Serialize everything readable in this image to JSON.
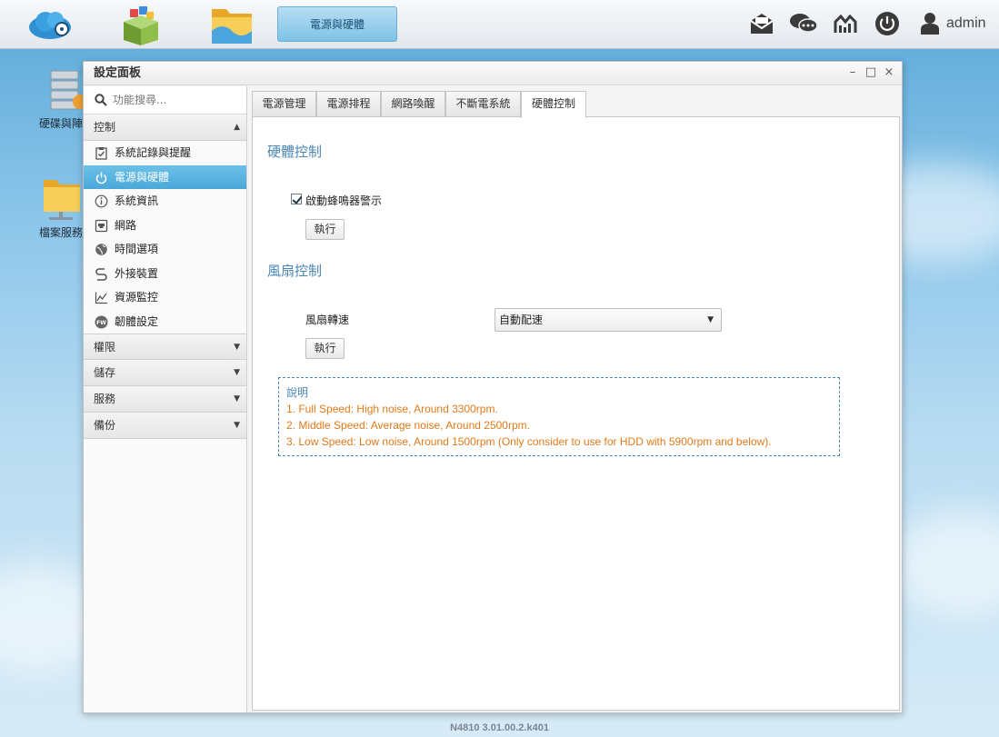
{
  "taskbar": {
    "active_task_label": "電源與硬體",
    "user_label": "admin",
    "icons": [
      "cloud-app-icon",
      "app-center-icon",
      "file-manager-icon",
      "mail-icon",
      "chat-icon",
      "tools-icon",
      "power-icon",
      "user-icon"
    ]
  },
  "desktop": {
    "icons": [
      {
        "label": "硬碟與陣列",
        "icon": "storage-icon"
      },
      {
        "label": "檔案服務",
        "icon": "folder-share-icon"
      }
    ]
  },
  "window": {
    "title": "設定面板",
    "controls": {
      "minimize": "–",
      "maximize": "□",
      "close": "×"
    }
  },
  "sidebar": {
    "search_placeholder": "功能搜尋...",
    "sections": [
      {
        "label": "控制",
        "expanded": true
      },
      {
        "label": "權限",
        "expanded": false
      },
      {
        "label": "儲存",
        "expanded": false
      },
      {
        "label": "服務",
        "expanded": false
      },
      {
        "label": "備份",
        "expanded": false
      }
    ],
    "items": [
      {
        "label": "系統記錄與提醒",
        "icon": "clipboard-check-icon"
      },
      {
        "label": "電源與硬體",
        "icon": "power-icon",
        "active": true
      },
      {
        "label": "系統資訊",
        "icon": "info-icon"
      },
      {
        "label": "網路",
        "icon": "network-port-icon"
      },
      {
        "label": "時間選項",
        "icon": "globe-clock-icon"
      },
      {
        "label": "外接裝置",
        "icon": "usb-cable-icon"
      },
      {
        "label": "資源監控",
        "icon": "line-chart-icon"
      },
      {
        "label": "韌體設定",
        "icon": "firmware-icon"
      }
    ]
  },
  "tabs": [
    {
      "label": "電源管理"
    },
    {
      "label": "電源排程"
    },
    {
      "label": "網路喚醒"
    },
    {
      "label": "不斷電系統"
    },
    {
      "label": "硬體控制",
      "active": true
    }
  ],
  "hardware": {
    "title": "硬體控制",
    "buzzer_label": "啟動蜂鳴器警示",
    "buzzer_checked": true,
    "apply_label": "執行"
  },
  "fan": {
    "title": "風扇控制",
    "speed_label": "風扇轉速",
    "speed_value": "自動配速",
    "apply_label": "執行"
  },
  "info": {
    "heading": "說明",
    "lines": [
      "1. Full Speed: High noise, Around 3300rpm.",
      "2. Middle Speed: Average noise, Around 2500rpm.",
      "3. Low Speed: Low noise, Around 1500rpm (Only consider to use for HDD with 5900rpm and below)."
    ]
  },
  "footer": {
    "version": "N4810   3.01.00.2.k401"
  },
  "colors": {
    "accent": "#4a86b4",
    "active_item": "#4aa8d8",
    "note_text": "#e07a1a"
  }
}
